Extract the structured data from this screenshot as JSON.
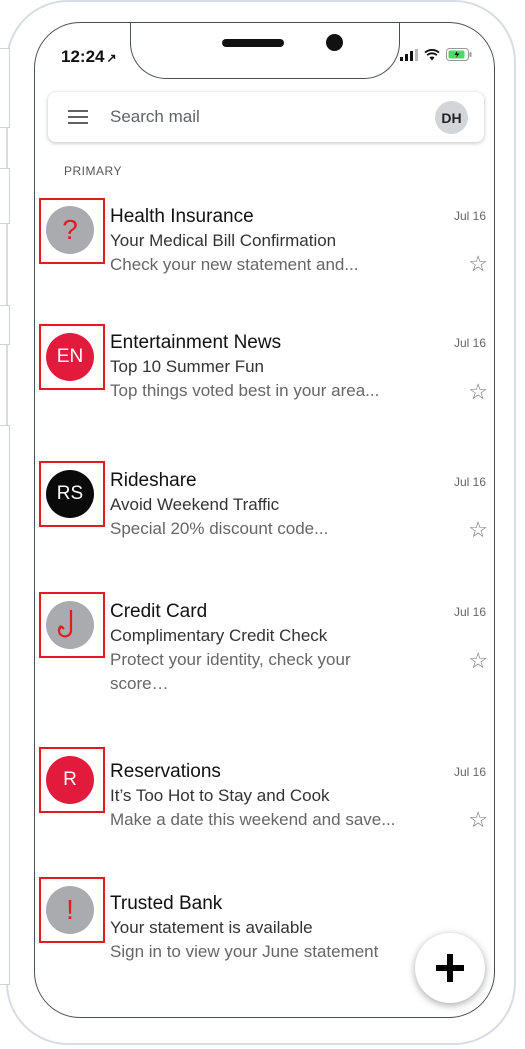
{
  "status_bar": {
    "time": "12:24",
    "location_glyph": "↗"
  },
  "search": {
    "placeholder": "Search mail",
    "avatar_initials": "DH"
  },
  "section_label": "PRIMARY",
  "emails": [
    {
      "sender": "Health Insurance",
      "subject": "Your Medical Bill Confirmation",
      "snippet": "Check your new statement and...",
      "date": "Jul 16",
      "avatar_text": "?",
      "avatar_bg": "#a9abae",
      "avatar_fg": "#e21b23",
      "icon": "question-icon",
      "highlighted": true
    },
    {
      "sender": "Entertainment News",
      "subject": "Top 10 Summer Fun",
      "snippet": "Top things voted best in your area...",
      "date": "Jul 16",
      "avatar_text": "EN",
      "avatar_bg": "#e21b3c",
      "avatar_fg": "#ffffff",
      "icon": "",
      "highlighted": true
    },
    {
      "sender": "Rideshare",
      "subject": "Avoid Weekend Traffic",
      "snippet": "Special 20% discount code...",
      "date": "Jul 16",
      "avatar_text": "RS",
      "avatar_bg": "#0a0a0a",
      "avatar_fg": "#ffffff",
      "icon": "",
      "highlighted": true
    },
    {
      "sender": "Credit Card",
      "subject": "Complimentary Credit Check",
      "snippet": "Protect your identity, check your score…",
      "date": "Jul 16",
      "avatar_text": "",
      "avatar_bg": "#a9abae",
      "avatar_fg": "#e21b23",
      "icon": "fishhook-icon",
      "highlighted": true
    },
    {
      "sender": "Reservations",
      "subject": "It’s Too Hot to Stay and Cook",
      "snippet": "Make a date this weekend and save...",
      "date": "Jul 16",
      "avatar_text": "R",
      "avatar_bg": "#e21b3c",
      "avatar_fg": "#ffffff",
      "icon": "",
      "highlighted": true
    },
    {
      "sender": "Trusted Bank",
      "subject": "Your statement is available",
      "snippet": "Sign in to view your June statement",
      "date": "",
      "avatar_text": "!",
      "avatar_bg": "#a9abae",
      "avatar_fg": "#e21b23",
      "icon": "exclamation-icon",
      "highlighted": true
    }
  ],
  "fab": {
    "icon": "plus-icon"
  },
  "colors": {
    "highlight": "#e21b23",
    "accent_red": "#e21b3c"
  }
}
